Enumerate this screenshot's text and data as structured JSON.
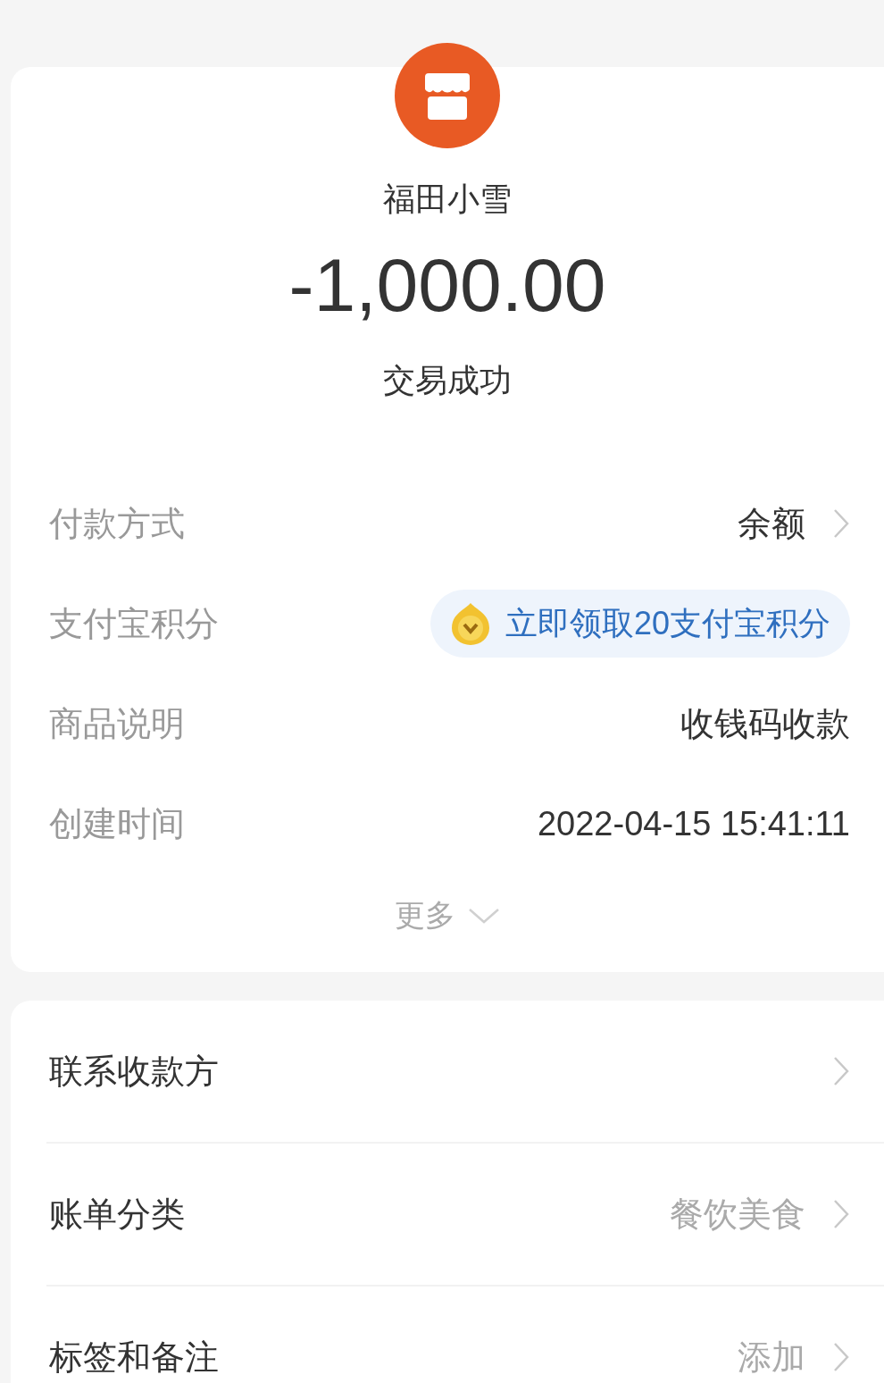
{
  "merchant": {
    "name": "福田小雪",
    "amount": "-1,000.00",
    "status": "交易成功"
  },
  "details": [
    {
      "label": "付款方式",
      "kind": "link",
      "value": "余额"
    },
    {
      "label": "支付宝积分",
      "kind": "badge",
      "value": "立即领取20支付宝积分"
    },
    {
      "label": "商品说明",
      "kind": "plain",
      "value": "收钱码收款"
    },
    {
      "label": "创建时间",
      "kind": "plain",
      "value": "2022-04-15 15:41:11"
    }
  ],
  "more": {
    "label": "更多",
    "expanded": false
  },
  "actions": [
    {
      "label": "联系收款方"
    },
    {
      "label": "账单分类",
      "value": "餐饮美食"
    },
    {
      "label": "标签和备注",
      "value": "添加"
    }
  ]
}
